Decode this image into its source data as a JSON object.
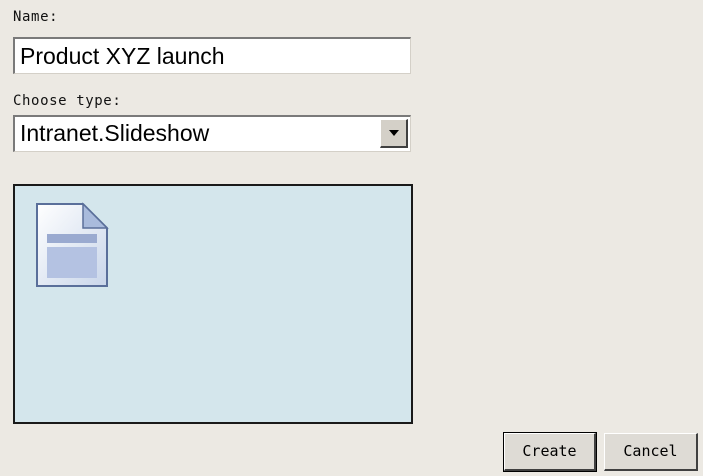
{
  "form": {
    "name_label": "Name:",
    "name_value": "Product XYZ launch",
    "type_label": "Choose type:",
    "type_selected": "Intranet.Slideshow"
  },
  "preview": {
    "icon": "document-icon"
  },
  "buttons": {
    "create_label": "Create",
    "cancel_label": "Cancel"
  },
  "colors": {
    "background": "#ece9e3",
    "preview_background": "#d4e6ec",
    "field_background": "#ffffff"
  }
}
